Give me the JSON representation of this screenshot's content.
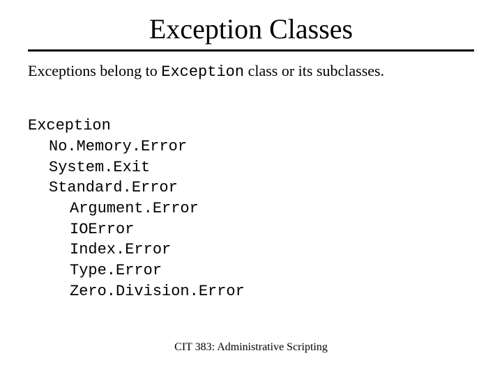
{
  "title": "Exception Classes",
  "intro_pre": "Exceptions belong to ",
  "intro_code": "Exception",
  "intro_post": " class or its subclasses.",
  "tree": {
    "root": "Exception",
    "l1_a": "No.Memory.Error",
    "l1_b": "System.Exit",
    "l1_c": "Standard.Error",
    "l2_a": "Argument.Error",
    "l2_b": "IOError",
    "l2_c": "Index.Error",
    "l2_d": "Type.Error",
    "l2_e": "Zero.Division.Error"
  },
  "footer": "CIT 383: Administrative Scripting"
}
